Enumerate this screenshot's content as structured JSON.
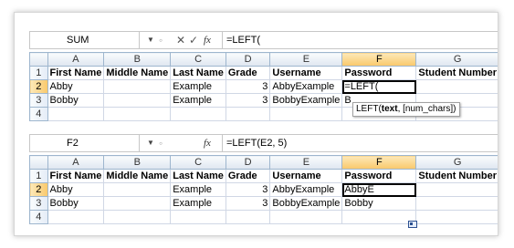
{
  "pane1": {
    "name_box": "SUM",
    "formula": "=LEFT(",
    "buttons": {
      "cancel": "✕",
      "enter": "✓",
      "fx": "fx"
    },
    "columns": [
      "A",
      "B",
      "C",
      "D",
      "E",
      "F",
      "G"
    ],
    "rows": [
      {
        "n": "1",
        "cells": [
          "First Name",
          "Middle Name",
          "Last Name",
          "Grade",
          "Username",
          "Password",
          "Student Number"
        ]
      },
      {
        "n": "2",
        "cells": [
          "Abby",
          "",
          "Example",
          "3",
          "AbbyExample",
          "=LEFT(",
          ""
        ]
      },
      {
        "n": "3",
        "cells": [
          "Bobby",
          "",
          "Example",
          "3",
          "BobbyExample",
          "B",
          ""
        ]
      },
      {
        "n": "4",
        "cells": [
          "",
          "",
          "",
          "",
          "",
          "",
          ""
        ]
      }
    ],
    "tooltip": {
      "fn": "LEFT(",
      "arg1": "text",
      "rest": ", [num_chars])"
    }
  },
  "pane2": {
    "name_box": "F2",
    "formula": "=LEFT(E2, 5)",
    "buttons": {
      "fx": "fx"
    },
    "columns": [
      "A",
      "B",
      "C",
      "D",
      "E",
      "F",
      "G"
    ],
    "rows": [
      {
        "n": "1",
        "cells": [
          "First Name",
          "Middle Name",
          "Last Name",
          "Grade",
          "Username",
          "Password",
          "Student Number"
        ]
      },
      {
        "n": "2",
        "cells": [
          "Abby",
          "",
          "Example",
          "3",
          "AbbyExample",
          "AbbyE",
          ""
        ]
      },
      {
        "n": "3",
        "cells": [
          "Bobby",
          "",
          "Example",
          "3",
          "BobbyExample",
          "Bobby",
          ""
        ]
      },
      {
        "n": "4",
        "cells": [
          "",
          "",
          "",
          "",
          "",
          "",
          ""
        ]
      }
    ]
  }
}
